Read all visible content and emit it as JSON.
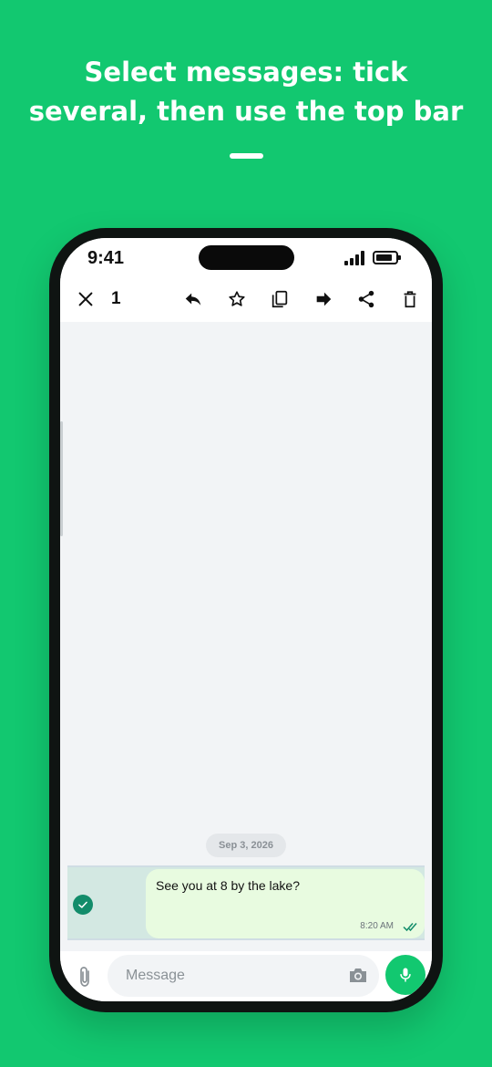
{
  "headline": {
    "line1": "Select messages: tick",
    "line2": "several, then use the top bar"
  },
  "status": {
    "time": "9:41"
  },
  "action_bar": {
    "selected_count": "1",
    "icons": [
      "close-icon",
      "reply-icon",
      "star-icon",
      "copy-icon",
      "forward-icon",
      "share-icon",
      "delete-icon"
    ]
  },
  "chat": {
    "date_chip": "Sep 3, 2026",
    "messages": [
      {
        "text": "See you at 8 by the lake?",
        "time": "8:20 AM",
        "status": "read",
        "selected": true
      }
    ]
  },
  "composer": {
    "placeholder": "Message"
  },
  "colors": {
    "background": "#12C870",
    "accent": "#128C6A",
    "outgoing_bubble": "#E8FBE0",
    "selected_row": "#D3E8E2"
  }
}
